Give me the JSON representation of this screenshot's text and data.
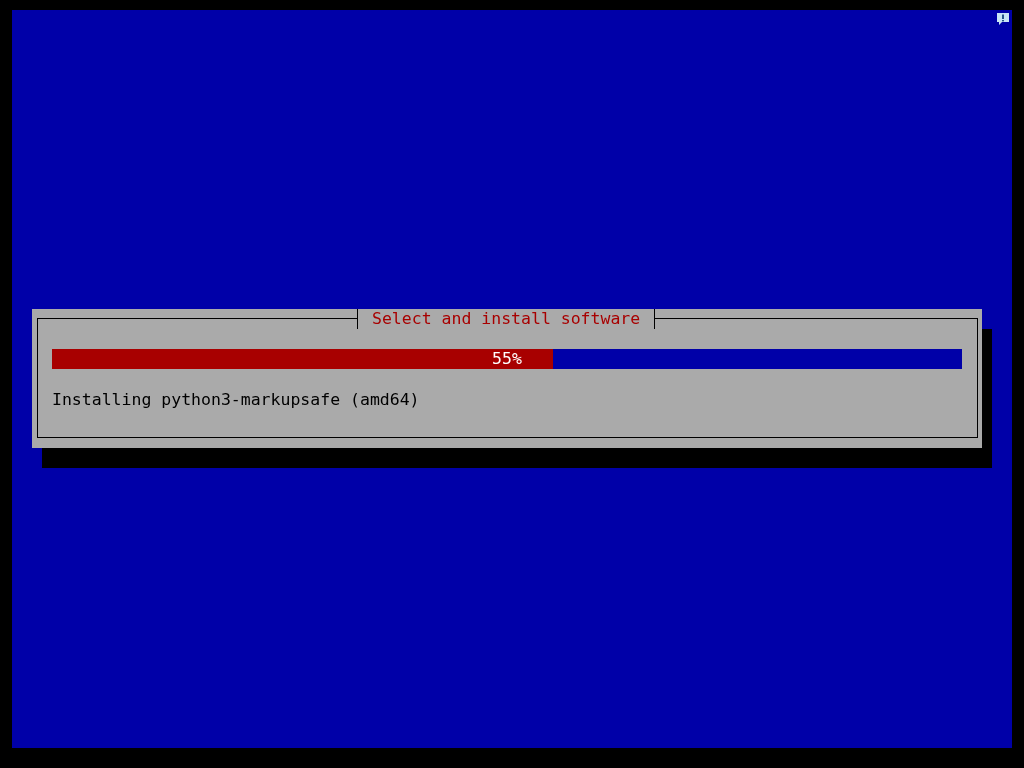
{
  "dialog": {
    "title": "Select and install software",
    "progress": {
      "level": 0.55,
      "label": "55%"
    },
    "status": "Installing python3-markupsafe (amd64)"
  }
}
